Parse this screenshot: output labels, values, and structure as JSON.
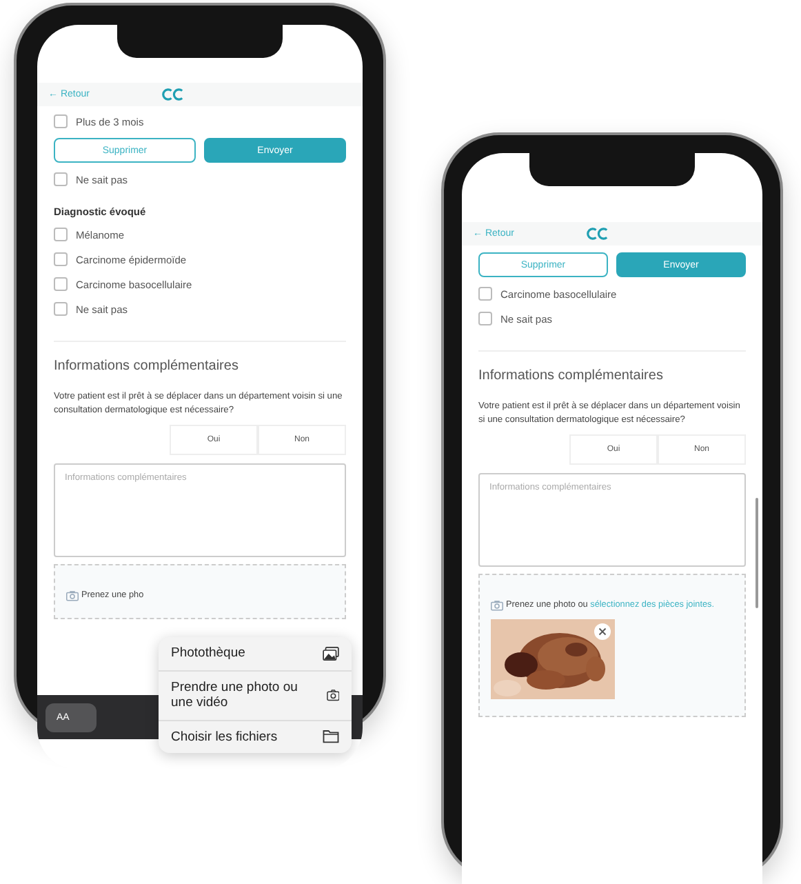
{
  "phones": [
    {
      "back": "← Retour",
      "actions": [
        {
          "label": "Supprimer",
          "kind": "outline"
        },
        {
          "label": "Envoyer",
          "kind": "primary"
        }
      ],
      "blocks": [
        {
          "kind": "option",
          "label": "Plus de 3 mois",
          "checked": false
        },
        {
          "kind": "actions"
        },
        {
          "kind": "option",
          "label": "Ne sait pas",
          "checked": false
        },
        {
          "kind": "heading",
          "text": "Diagnostic évoqué"
        },
        {
          "kind": "option",
          "label": "Mélanome",
          "checked": false
        },
        {
          "kind": "option",
          "label": "Carcinome épidermoïde",
          "checked": false
        },
        {
          "kind": "option",
          "label": "Carcinome basocellulaire",
          "checked": false
        },
        {
          "kind": "option",
          "label": "Ne sait pas",
          "checked": false
        },
        {
          "kind": "divider"
        },
        {
          "kind": "title",
          "text": "Informations complémentaires"
        },
        {
          "kind": "question",
          "text": "Votre patient est il prêt à se déplacer dans un département voisin si une consultation dermatologique est nécessaire?",
          "choices": [
            {
              "label": "Oui",
              "selected": false
            },
            {
              "label": "Non",
              "selected": false
            }
          ]
        },
        {
          "kind": "textarea",
          "placeholder": "Informations complémentaires"
        },
        {
          "kind": "upload",
          "prompt": "Prenez une pho"
        }
      ],
      "keyboard": {
        "key": "AA"
      },
      "menu": [
        {
          "label": "Photothèque",
          "kind": "gallery"
        },
        {
          "label": "Prendre une photo ou une vidéo",
          "kind": "camera"
        },
        {
          "label": "Choisir les fichiers",
          "kind": "folder"
        }
      ]
    },
    {
      "back": "← Retour",
      "actions": [
        {
          "label": "Supprimer",
          "kind": "outline"
        },
        {
          "label": "Envoyer",
          "kind": "primary"
        }
      ],
      "blocks": [
        {
          "kind": "actions"
        },
        {
          "kind": "option",
          "label": "Carcinome basocellulaire",
          "checked": false
        },
        {
          "kind": "option",
          "label": "Ne sait pas",
          "checked": false
        },
        {
          "kind": "divider"
        },
        {
          "kind": "title",
          "text": "Informations complémentaires"
        },
        {
          "kind": "question",
          "text": "Votre patient est il prêt à se déplacer dans un département voisin si une consultation dermatologique est nécessaire?",
          "choices": [
            {
              "label": "Oui",
              "selected": false
            },
            {
              "label": "Non",
              "selected": false
            }
          ]
        },
        {
          "kind": "textarea",
          "placeholder": "Informations complémentaires"
        },
        {
          "kind": "upload",
          "prompt": "Prenez une photo ou ",
          "link": "sélectionnez des pièces jointes."
        }
      ],
      "scrollbar": true
    }
  ]
}
